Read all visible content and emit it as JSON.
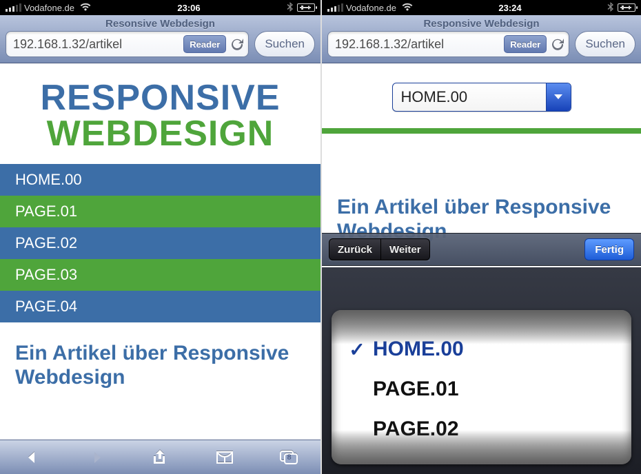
{
  "left": {
    "status": {
      "carrier": "Vodafone.de",
      "time": "23:06"
    },
    "safari": {
      "page_title": "Resonsive Webdesign",
      "url": "192.168.1.32/artikel",
      "reader_label": "Reader",
      "search_label": "Suchen"
    },
    "logo": {
      "line1": "RESPONSIVE",
      "line2": "WEBDESIGN"
    },
    "nav": [
      {
        "label": "HOME.00",
        "style": "blue"
      },
      {
        "label": "PAGE.01",
        "style": "green"
      },
      {
        "label": "PAGE.02",
        "style": "blue"
      },
      {
        "label": "PAGE.03",
        "style": "green"
      },
      {
        "label": "PAGE.04",
        "style": "blue"
      }
    ],
    "article_heading": "Ein Artikel über Responsive Webdesign",
    "toolbar_tab_count": "8"
  },
  "right": {
    "status": {
      "carrier": "Vodafone.de",
      "time": "23:24"
    },
    "safari": {
      "page_title": "Responsive Webdesign",
      "url": "192.168.1.32/artikel",
      "reader_label": "Reader",
      "search_label": "Suchen"
    },
    "select_value": "HOME.00",
    "ghost_heading": "Ein Artikel über Responsive Webdesign",
    "accessory": {
      "prev": "Zurück",
      "next": "Weiter",
      "done": "Fertig"
    },
    "picker_options": [
      {
        "label": "HOME.00",
        "selected": true
      },
      {
        "label": "PAGE.01",
        "selected": false
      },
      {
        "label": "PAGE.02",
        "selected": false
      }
    ]
  }
}
